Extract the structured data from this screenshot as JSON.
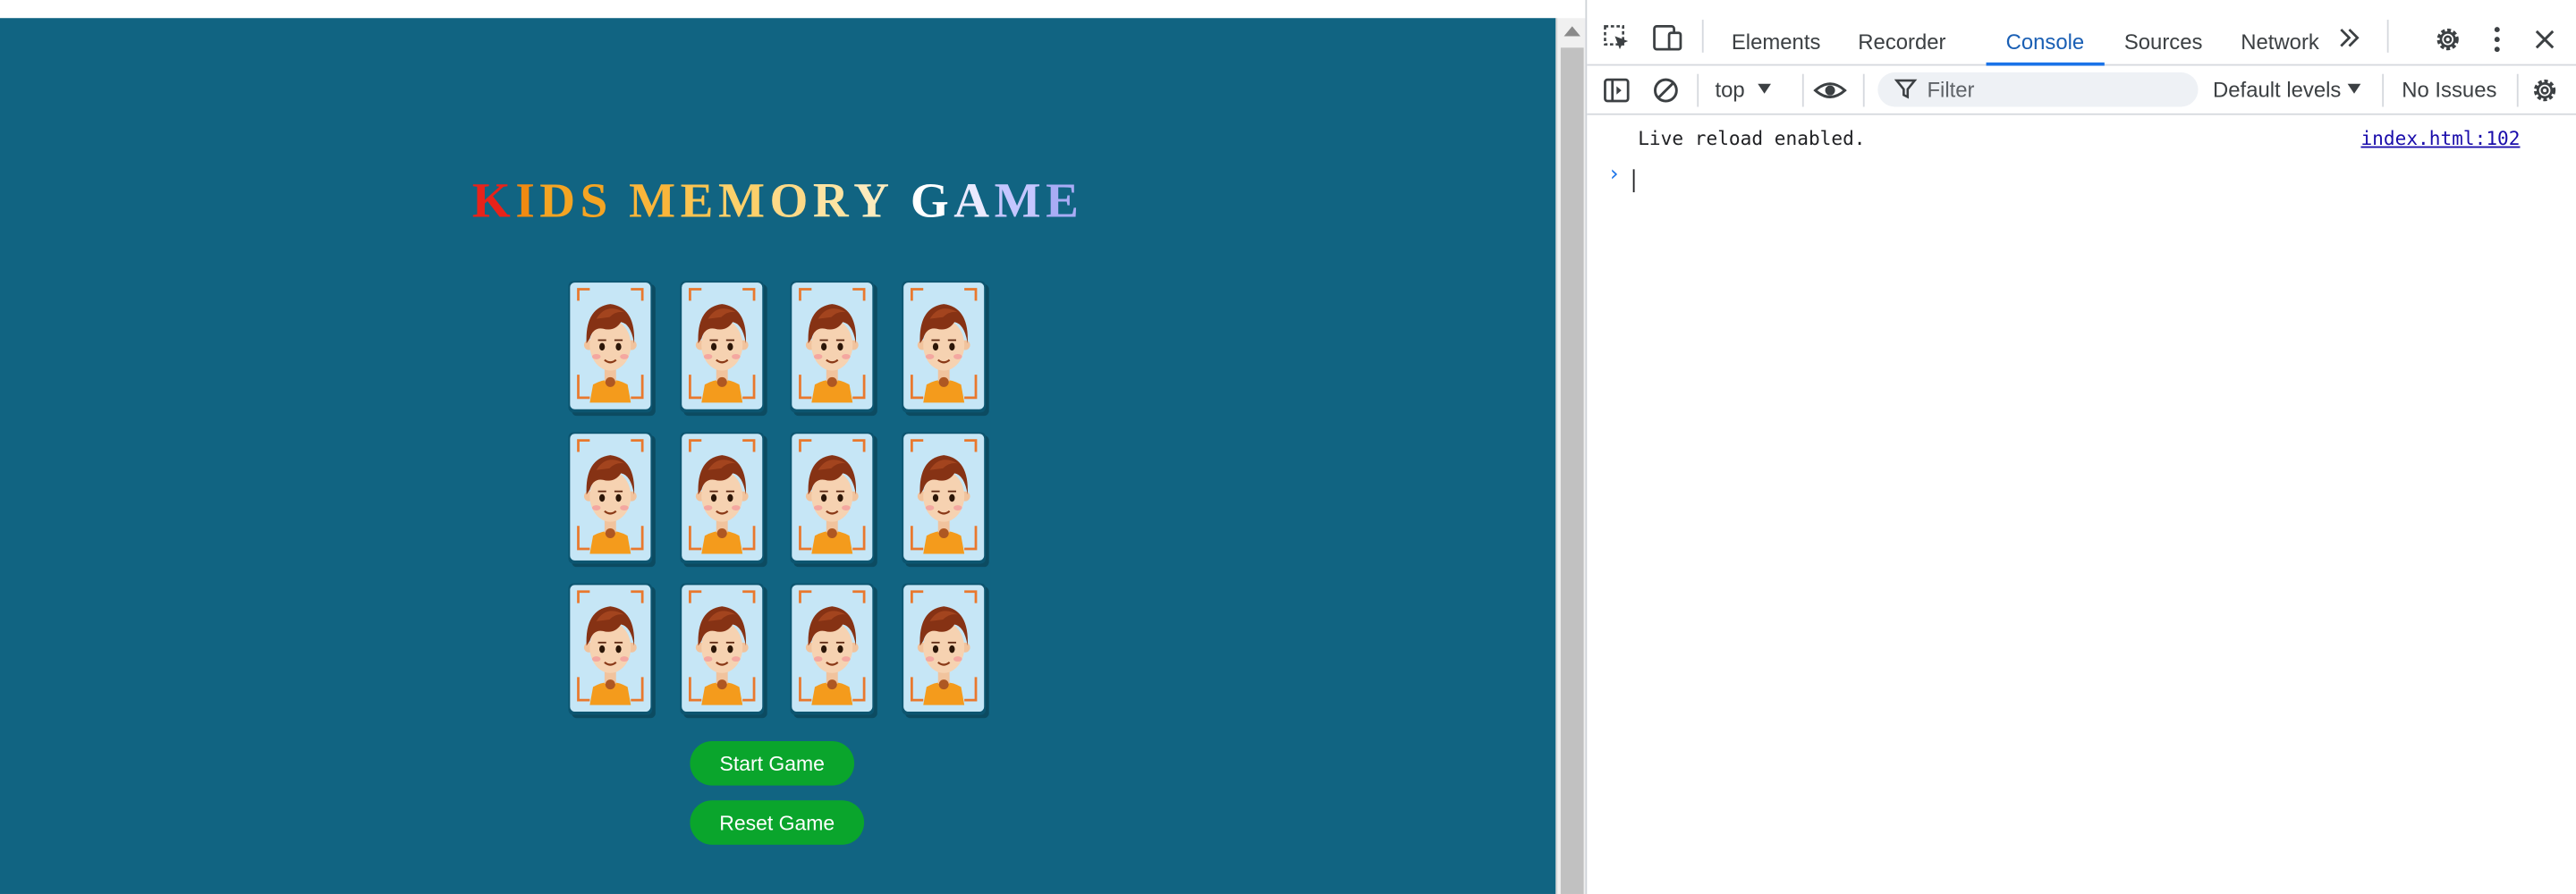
{
  "game": {
    "title": [
      "K",
      "I",
      "D",
      "S",
      " ",
      "M",
      "E",
      "M",
      "O",
      "R",
      "Y",
      " ",
      "G",
      "A",
      "M",
      "E"
    ],
    "title_colors": [
      "#e8231a",
      "#f08a12",
      "#f4a423",
      "#f4a423",
      "#ffffff",
      "#f9b53a",
      "#fbc451",
      "#fcd06a",
      "#fdd987",
      "#fde3a2",
      "#fdebbd",
      "#ffffff",
      "#ffffff",
      "#eaeaff",
      "#c5c6ff",
      "#a9acf5"
    ],
    "background": "#116482",
    "card_icon": "boy-face-icon",
    "cards": [
      {
        "row": 1,
        "col": 1
      },
      {
        "row": 1,
        "col": 2
      },
      {
        "row": 1,
        "col": 3
      },
      {
        "row": 1,
        "col": 4
      },
      {
        "row": 2,
        "col": 1
      },
      {
        "row": 2,
        "col": 2
      },
      {
        "row": 2,
        "col": 3
      },
      {
        "row": 2,
        "col": 4
      },
      {
        "row": 3,
        "col": 1
      },
      {
        "row": 3,
        "col": 2
      },
      {
        "row": 3,
        "col": 3
      },
      {
        "row": 3,
        "col": 4
      }
    ],
    "start_label": "Start Game",
    "reset_label": "Reset Game",
    "button_color": "#0aa52c"
  },
  "devtools": {
    "tabs": [
      {
        "label": "Elements",
        "active": false
      },
      {
        "label": "Recorder",
        "active": false
      },
      {
        "label": "Console",
        "active": true
      },
      {
        "label": "Sources",
        "active": false
      },
      {
        "label": "Network",
        "active": false
      }
    ],
    "more_tabs_icon": "double-chevron-icon",
    "context": "top",
    "filter_placeholder": "Filter",
    "levels": "Default levels",
    "issues": "No Issues",
    "console": {
      "message": "Live reload enabled.",
      "source": "index.html:102"
    },
    "prompt_symbol": "›",
    "accent": "#1a73e8"
  }
}
